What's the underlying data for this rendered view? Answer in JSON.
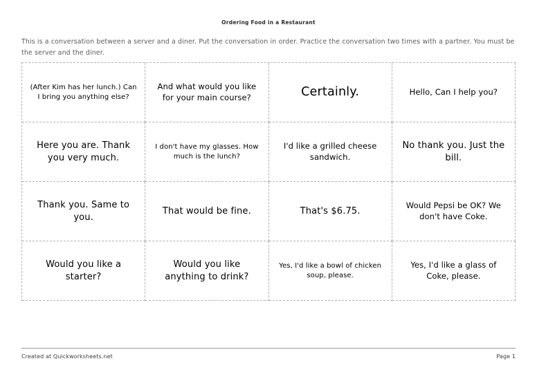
{
  "header": {
    "title": "Ordering Food in a Restaurant"
  },
  "instructions": {
    "text": "This is a conversation between a server and a diner.  Put the conversation in order.  Practice the conversation two times with a partner.  You must be the server and the diner."
  },
  "grid": {
    "columns": 4,
    "rows": 4,
    "border_color": "#b0b0b0",
    "cells": [
      {
        "text": "(After Kim has her lunch.) Can I bring you anything else?",
        "size": "sm"
      },
      {
        "text": "And what would you like for your main course?",
        "size": "md"
      },
      {
        "text": "Certainly.",
        "size": "xl"
      },
      {
        "text": "Hello, Can I help you?",
        "size": "md"
      },
      {
        "text": "Here you are. Thank you very much.",
        "size": "lg"
      },
      {
        "text": "I don't have my glasses. How much is the lunch?",
        "size": "sm"
      },
      {
        "text": "I'd like a grilled cheese sandwich.",
        "size": "md"
      },
      {
        "text": "No thank you. Just the bill.",
        "size": "lg"
      },
      {
        "text": "Thank you. Same to you.",
        "size": "lg"
      },
      {
        "text": "That would be fine.",
        "size": "lg"
      },
      {
        "text": "That's $6.75.",
        "size": "lg"
      },
      {
        "text": "Would Pepsi be OK? We don't have Coke.",
        "size": "md"
      },
      {
        "text": "Would you like a starter?",
        "size": "lg"
      },
      {
        "text": "Would you like anything to drink?",
        "size": "lg"
      },
      {
        "text": "Yes, I'd like a bowl of chicken soup, please.",
        "size": "sm"
      },
      {
        "text": "Yes, I'd like a glass of Coke, please.",
        "size": "md"
      }
    ]
  },
  "footer": {
    "credit": "Created at Quickworksheets.net",
    "page_label": "Page 1"
  }
}
